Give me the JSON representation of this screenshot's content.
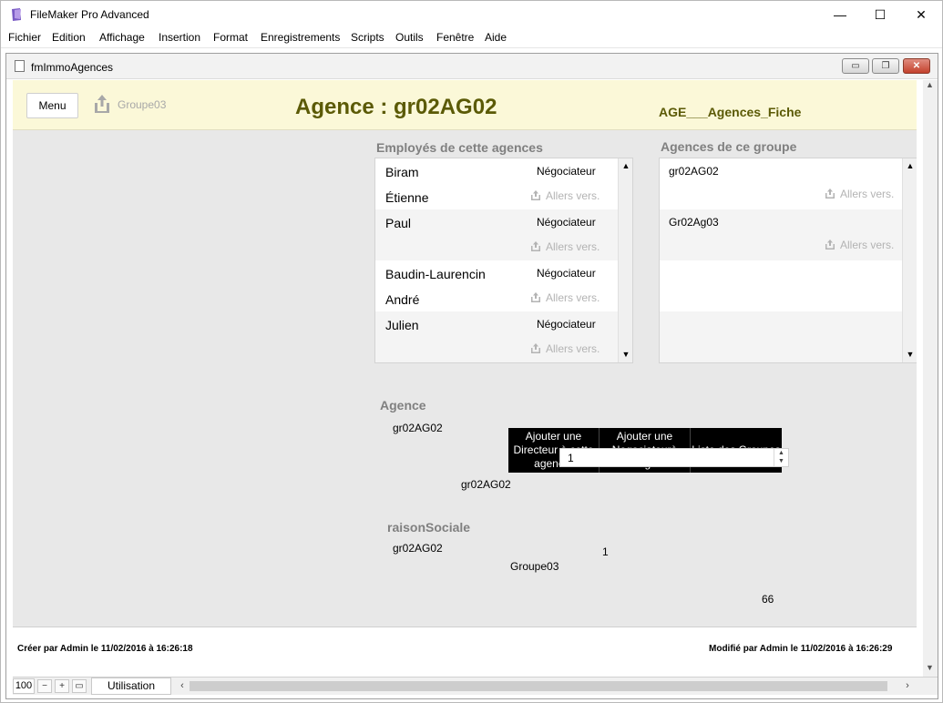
{
  "app": {
    "title": "FileMaker Pro Advanced"
  },
  "menu": [
    "Fichier",
    "Edition",
    "Affichage",
    "Insertion",
    "Format",
    "Enregistrements",
    "Scripts",
    "Outils",
    "Fenêtre",
    "Aide"
  ],
  "doc": {
    "title": "fmImmoAgences"
  },
  "header": {
    "menu_button": "Menu",
    "group_label": "Groupe03",
    "agence_title": "Agence : gr02AG02",
    "layout_name": "AGE___Agences_Fiche"
  },
  "employees": {
    "label": "Employés de cette agences",
    "goto_label": "Allers vers.",
    "rows": [
      {
        "name": "Biram",
        "role": "Négociateur"
      },
      {
        "name": "Étienne",
        "role": ""
      },
      {
        "name": "Paul",
        "role": "Négociateur"
      },
      {
        "name": "",
        "role": ""
      },
      {
        "name": "Baudin-Laurencin",
        "role": "Négociateur"
      },
      {
        "name": "André",
        "role": ""
      },
      {
        "name": "Julien",
        "role": "Négociateur"
      },
      {
        "name": "",
        "role": ""
      }
    ]
  },
  "groupe_agences": {
    "label": "Agences de ce groupe",
    "goto_label": "Allers vers.",
    "rows": [
      "gr02AG02",
      "Gr02Ag03"
    ]
  },
  "fields": {
    "agence_label": "Agence",
    "agence_value": "gr02AG02",
    "agence_value2": "gr02AG02",
    "number_value": "1",
    "raison_label": "raisonSociale",
    "raison_value": "gr02AG02",
    "count_value": "1",
    "group_value": "Groupe03",
    "total_value": "66"
  },
  "buttons": {
    "add_director": "Ajouter une Directeur à cette agence.",
    "add_negociateur": "Ajouter une Negociateurà cette agence.",
    "list_groups": "Liste des Groupes"
  },
  "footer": {
    "created": "Créer par Admin le 11/02/2016 à 16:26:18",
    "modified": "Modifié par Admin le 11/02/2016 à 16:26:29"
  },
  "statusbar": {
    "zoom": "100",
    "mode": "Utilisation"
  },
  "colors": {
    "header_band": "#fbf8d8",
    "title_olive": "#5b5a06",
    "content_bg": "#e8e8e8"
  }
}
